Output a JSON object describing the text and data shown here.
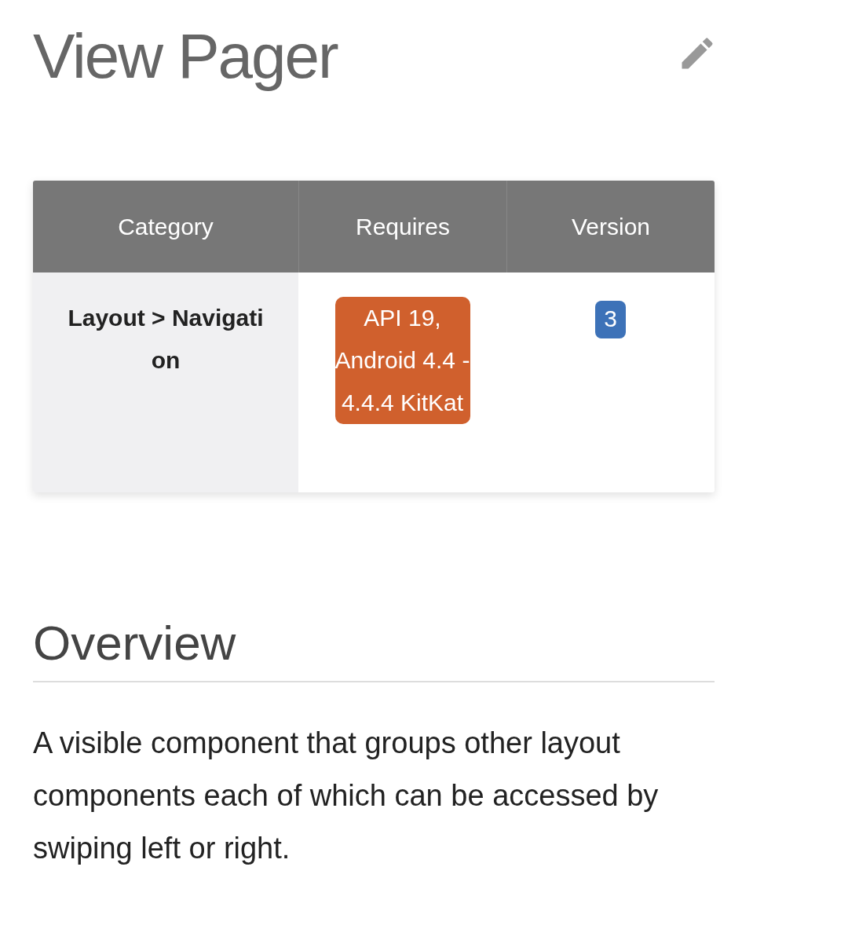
{
  "title": "View Pager",
  "table": {
    "columns": [
      "Category",
      "Requires",
      "Version"
    ],
    "rows": [
      {
        "category": "Layout > Navigation",
        "requires": "API 19, Android 4.4 - 4.4.4 KitKat",
        "version": "3"
      }
    ]
  },
  "overview": {
    "heading": "Overview",
    "text": "A visible component that groups other layout components each of which can be accessed by swiping left or right."
  }
}
